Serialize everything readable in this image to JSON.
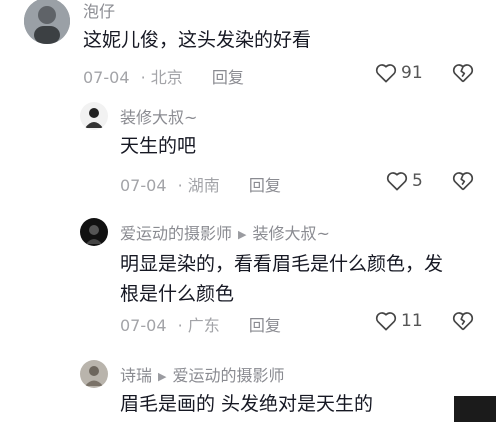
{
  "comments": [
    {
      "user": "泡仔",
      "text": "这妮儿俊，这头发染的好看",
      "date": "07-04",
      "location": "北京",
      "reply_label": "回复",
      "likes": "91"
    },
    {
      "user": "装修大叔",
      "user_suffix": "~",
      "text": "天生的吧",
      "date": "07-04",
      "location": "湖南",
      "reply_label": "回复",
      "likes": "5"
    },
    {
      "user": "爱运动的摄影师",
      "reply_to": "装修大叔",
      "reply_to_suffix": "~",
      "text_line1": "明显是染的，看看眉毛是什么颜色，发",
      "text_line2": "根是什么颜色",
      "date": "07-04",
      "location": "广东",
      "reply_label": "回复",
      "likes": "11"
    },
    {
      "user": "诗瑞",
      "reply_to": "爱运动的摄影师",
      "text": "眉毛是画的 头发绝对是天生的"
    }
  ],
  "icons": {
    "like": "heart-outline-icon",
    "dislike": "broken-heart-icon",
    "reply_arrow": "right-triangle-icon"
  },
  "colors": {
    "text": "#161823",
    "secondary": "#8a8b91",
    "muted": "#a3a4a8"
  }
}
